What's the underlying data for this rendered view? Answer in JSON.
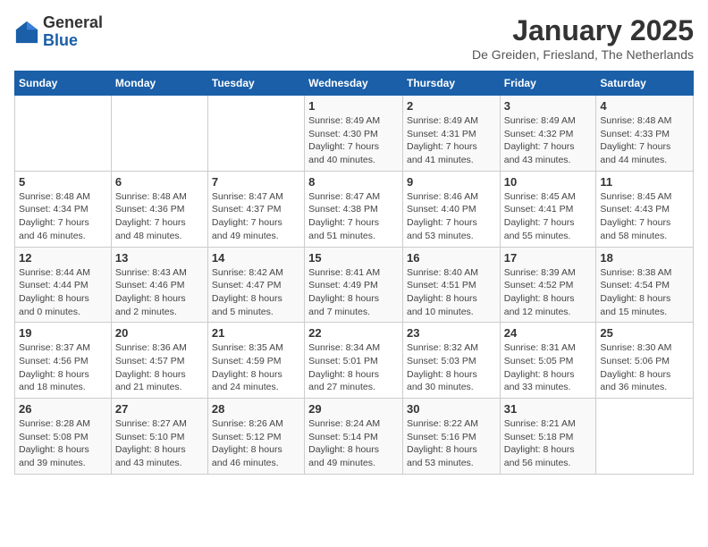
{
  "logo": {
    "general": "General",
    "blue": "Blue"
  },
  "title": "January 2025",
  "location": "De Greiden, Friesland, The Netherlands",
  "days_header": [
    "Sunday",
    "Monday",
    "Tuesday",
    "Wednesday",
    "Thursday",
    "Friday",
    "Saturday"
  ],
  "weeks": [
    [
      {
        "day": "",
        "info": ""
      },
      {
        "day": "",
        "info": ""
      },
      {
        "day": "",
        "info": ""
      },
      {
        "day": "1",
        "info": "Sunrise: 8:49 AM\nSunset: 4:30 PM\nDaylight: 7 hours\nand 40 minutes."
      },
      {
        "day": "2",
        "info": "Sunrise: 8:49 AM\nSunset: 4:31 PM\nDaylight: 7 hours\nand 41 minutes."
      },
      {
        "day": "3",
        "info": "Sunrise: 8:49 AM\nSunset: 4:32 PM\nDaylight: 7 hours\nand 43 minutes."
      },
      {
        "day": "4",
        "info": "Sunrise: 8:48 AM\nSunset: 4:33 PM\nDaylight: 7 hours\nand 44 minutes."
      }
    ],
    [
      {
        "day": "5",
        "info": "Sunrise: 8:48 AM\nSunset: 4:34 PM\nDaylight: 7 hours\nand 46 minutes."
      },
      {
        "day": "6",
        "info": "Sunrise: 8:48 AM\nSunset: 4:36 PM\nDaylight: 7 hours\nand 48 minutes."
      },
      {
        "day": "7",
        "info": "Sunrise: 8:47 AM\nSunset: 4:37 PM\nDaylight: 7 hours\nand 49 minutes."
      },
      {
        "day": "8",
        "info": "Sunrise: 8:47 AM\nSunset: 4:38 PM\nDaylight: 7 hours\nand 51 minutes."
      },
      {
        "day": "9",
        "info": "Sunrise: 8:46 AM\nSunset: 4:40 PM\nDaylight: 7 hours\nand 53 minutes."
      },
      {
        "day": "10",
        "info": "Sunrise: 8:45 AM\nSunset: 4:41 PM\nDaylight: 7 hours\nand 55 minutes."
      },
      {
        "day": "11",
        "info": "Sunrise: 8:45 AM\nSunset: 4:43 PM\nDaylight: 7 hours\nand 58 minutes."
      }
    ],
    [
      {
        "day": "12",
        "info": "Sunrise: 8:44 AM\nSunset: 4:44 PM\nDaylight: 8 hours\nand 0 minutes."
      },
      {
        "day": "13",
        "info": "Sunrise: 8:43 AM\nSunset: 4:46 PM\nDaylight: 8 hours\nand 2 minutes."
      },
      {
        "day": "14",
        "info": "Sunrise: 8:42 AM\nSunset: 4:47 PM\nDaylight: 8 hours\nand 5 minutes."
      },
      {
        "day": "15",
        "info": "Sunrise: 8:41 AM\nSunset: 4:49 PM\nDaylight: 8 hours\nand 7 minutes."
      },
      {
        "day": "16",
        "info": "Sunrise: 8:40 AM\nSunset: 4:51 PM\nDaylight: 8 hours\nand 10 minutes."
      },
      {
        "day": "17",
        "info": "Sunrise: 8:39 AM\nSunset: 4:52 PM\nDaylight: 8 hours\nand 12 minutes."
      },
      {
        "day": "18",
        "info": "Sunrise: 8:38 AM\nSunset: 4:54 PM\nDaylight: 8 hours\nand 15 minutes."
      }
    ],
    [
      {
        "day": "19",
        "info": "Sunrise: 8:37 AM\nSunset: 4:56 PM\nDaylight: 8 hours\nand 18 minutes."
      },
      {
        "day": "20",
        "info": "Sunrise: 8:36 AM\nSunset: 4:57 PM\nDaylight: 8 hours\nand 21 minutes."
      },
      {
        "day": "21",
        "info": "Sunrise: 8:35 AM\nSunset: 4:59 PM\nDaylight: 8 hours\nand 24 minutes."
      },
      {
        "day": "22",
        "info": "Sunrise: 8:34 AM\nSunset: 5:01 PM\nDaylight: 8 hours\nand 27 minutes."
      },
      {
        "day": "23",
        "info": "Sunrise: 8:32 AM\nSunset: 5:03 PM\nDaylight: 8 hours\nand 30 minutes."
      },
      {
        "day": "24",
        "info": "Sunrise: 8:31 AM\nSunset: 5:05 PM\nDaylight: 8 hours\nand 33 minutes."
      },
      {
        "day": "25",
        "info": "Sunrise: 8:30 AM\nSunset: 5:06 PM\nDaylight: 8 hours\nand 36 minutes."
      }
    ],
    [
      {
        "day": "26",
        "info": "Sunrise: 8:28 AM\nSunset: 5:08 PM\nDaylight: 8 hours\nand 39 minutes."
      },
      {
        "day": "27",
        "info": "Sunrise: 8:27 AM\nSunset: 5:10 PM\nDaylight: 8 hours\nand 43 minutes."
      },
      {
        "day": "28",
        "info": "Sunrise: 8:26 AM\nSunset: 5:12 PM\nDaylight: 8 hours\nand 46 minutes."
      },
      {
        "day": "29",
        "info": "Sunrise: 8:24 AM\nSunset: 5:14 PM\nDaylight: 8 hours\nand 49 minutes."
      },
      {
        "day": "30",
        "info": "Sunrise: 8:22 AM\nSunset: 5:16 PM\nDaylight: 8 hours\nand 53 minutes."
      },
      {
        "day": "31",
        "info": "Sunrise: 8:21 AM\nSunset: 5:18 PM\nDaylight: 8 hours\nand 56 minutes."
      },
      {
        "day": "",
        "info": ""
      }
    ]
  ]
}
